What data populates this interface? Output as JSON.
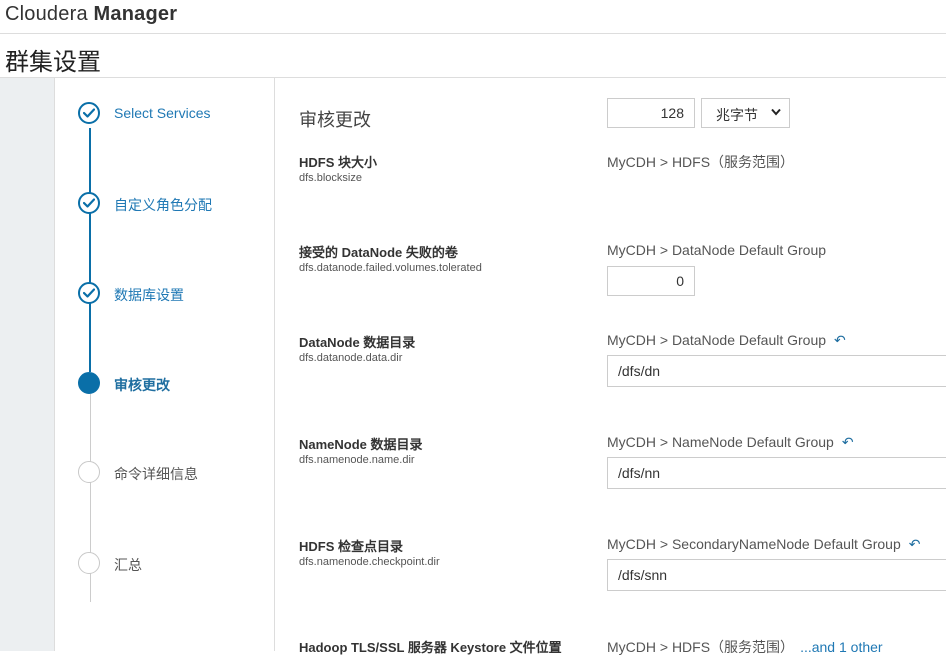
{
  "app": {
    "brand_light": "Cloudera ",
    "brand_bold": "Manager"
  },
  "page": {
    "title": "群集设置"
  },
  "wizard": {
    "steps": [
      {
        "label": "Select Services",
        "state": "done"
      },
      {
        "label": "自定义角色分配",
        "state": "done"
      },
      {
        "label": "数据库设置",
        "state": "done"
      },
      {
        "label": "审核更改",
        "state": "current"
      },
      {
        "label": "命令详细信息",
        "state": "todo"
      },
      {
        "label": "汇总",
        "state": "todo"
      }
    ]
  },
  "main": {
    "section_title": "审核更改",
    "settings": [
      {
        "name": "HDFS 块大小",
        "key": "dfs.blocksize",
        "scope": "MyCDH > HDFS（服务范围）",
        "value": "128",
        "unit": "兆字节"
      },
      {
        "name": "接受的 DataNode 失败的卷",
        "key": "dfs.datanode.failed.volumes.tolerated",
        "scope": "MyCDH > DataNode Default Group",
        "value": "0"
      },
      {
        "name": "DataNode 数据目录",
        "key": "dfs.datanode.data.dir",
        "scope": "MyCDH > DataNode Default Group",
        "value": "/dfs/dn"
      },
      {
        "name": "NameNode 数据目录",
        "key": "dfs.namenode.name.dir",
        "scope": "MyCDH > NameNode Default Group",
        "value": "/dfs/nn"
      },
      {
        "name": "HDFS 检查点目录",
        "key": "dfs.namenode.checkpoint.dir",
        "scope": "MyCDH > SecondaryNameNode Default Group",
        "value": "/dfs/snn"
      },
      {
        "name": "Hadoop TLS/SSL 服务器 Keystore 文件位置",
        "scope": "MyCDH > HDFS（服务范围）",
        "more": "...and 1 other"
      }
    ]
  },
  "icons": {
    "check": "check-icon",
    "undo": "undo-arrow-icon",
    "caret": "chevron-down-icon"
  },
  "colors": {
    "accent": "#0a6fa8",
    "link": "#1f78b4"
  }
}
